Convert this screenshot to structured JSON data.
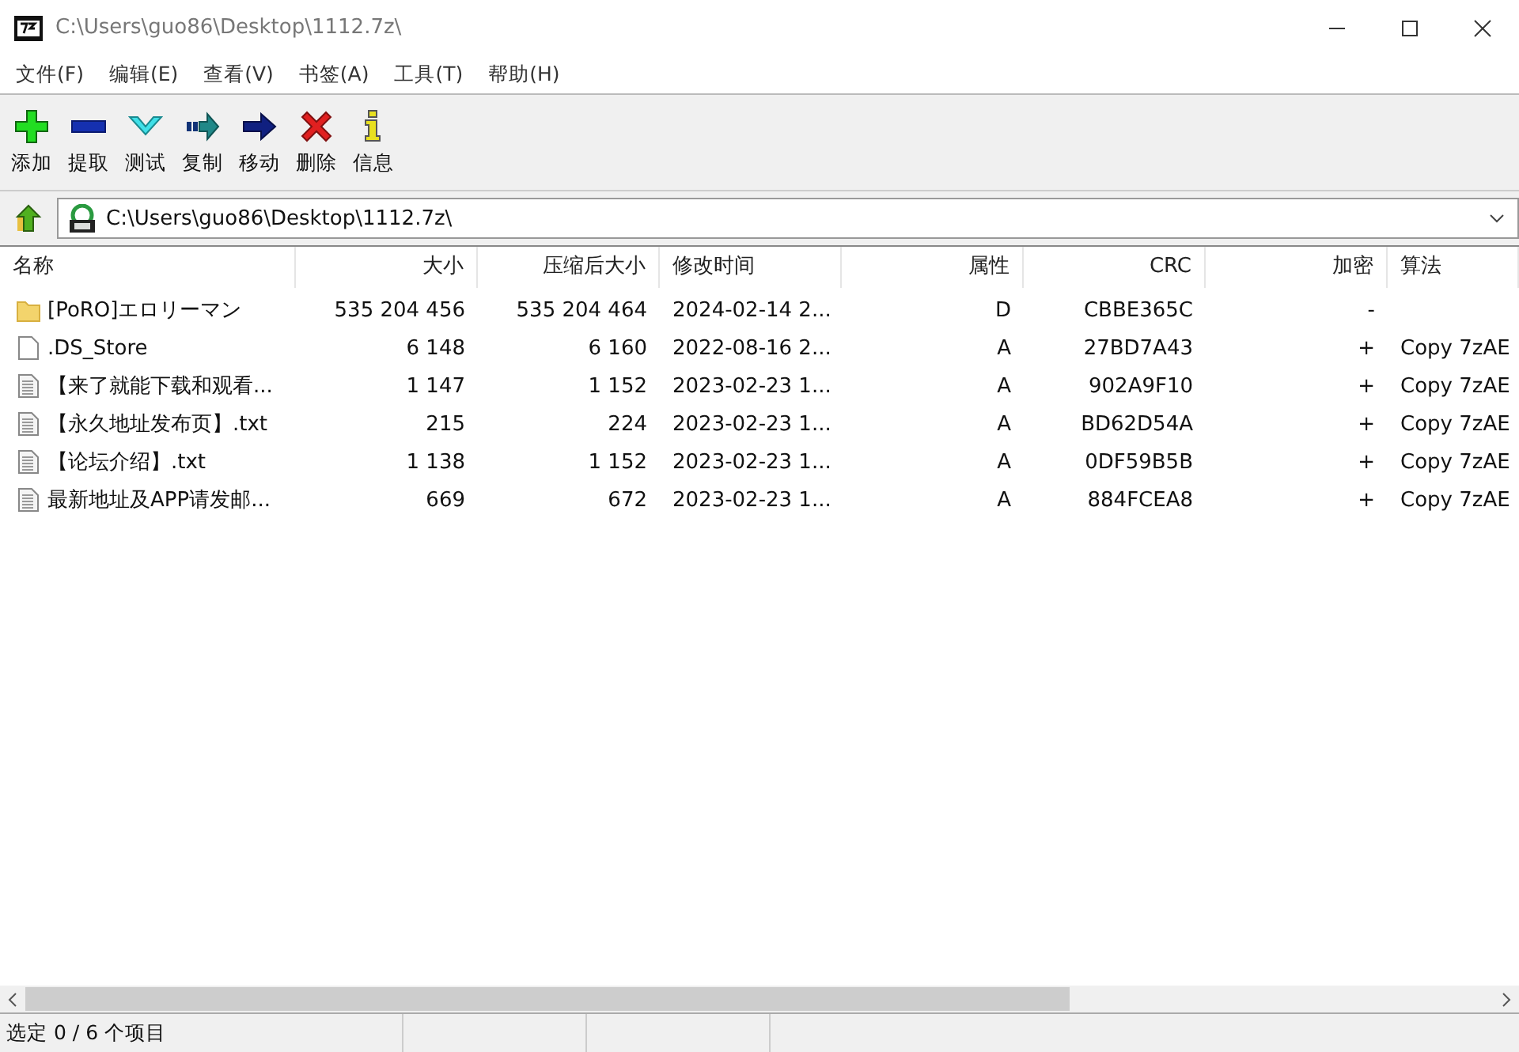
{
  "window": {
    "title": "C:\\Users\\guo86\\Desktop\\1112.7z\\"
  },
  "menu": [
    "文件(F)",
    "编辑(E)",
    "查看(V)",
    "书签(A)",
    "工具(T)",
    "帮助(H)"
  ],
  "toolbar": [
    {
      "kind": "add",
      "label": "添加"
    },
    {
      "kind": "extract",
      "label": "提取"
    },
    {
      "kind": "test",
      "label": "测试"
    },
    {
      "kind": "copy",
      "label": "复制"
    },
    {
      "kind": "move",
      "label": "移动"
    },
    {
      "kind": "delete",
      "label": "删除"
    },
    {
      "kind": "info",
      "label": "信息"
    }
  ],
  "address": {
    "value": "C:\\Users\\guo86\\Desktop\\1112.7z\\"
  },
  "table": {
    "columns": [
      "名称",
      "大小",
      "压缩后大小",
      "修改时间",
      "属性",
      "CRC",
      "加密",
      "算法"
    ],
    "rows": [
      {
        "kind": "folder",
        "cells": [
          "[PoRO]エロリーマン",
          "535 204 456",
          "535 204 464",
          "2024-02-14 2...",
          "D",
          "CBBE365C",
          "-"
        ]
      },
      {
        "kind": "file",
        "cells": [
          ".DS_Store",
          "6 148",
          "6 160",
          "2022-08-16 2...",
          "A",
          "27BD7A43",
          "+",
          "Copy 7zAE"
        ]
      },
      {
        "kind": "text",
        "cells": [
          "【来了就能下载和观看...",
          "1 147",
          "1 152",
          "2023-02-23 1...",
          "A",
          "902A9F10",
          "+",
          "Copy 7zAE"
        ]
      },
      {
        "kind": "text",
        "cells": [
          "【永久地址发布页】.txt",
          "215",
          "224",
          "2023-02-23 1...",
          "A",
          "BD62D54A",
          "+",
          "Copy 7zAE"
        ]
      },
      {
        "kind": "text",
        "cells": [
          "【论坛介绍】.txt",
          "1 138",
          "1 152",
          "2023-02-23 1...",
          "A",
          "0DF59B5B",
          "+",
          "Copy 7zAE"
        ]
      },
      {
        "kind": "text",
        "cells": [
          "最新地址及APP请发邮...",
          "669",
          "672",
          "2023-02-23 1...",
          "A",
          "884FCEA8",
          "+",
          "Copy 7zAE"
        ]
      }
    ]
  },
  "status_bar": {
    "text": "选定 0 / 6 个项目"
  }
}
